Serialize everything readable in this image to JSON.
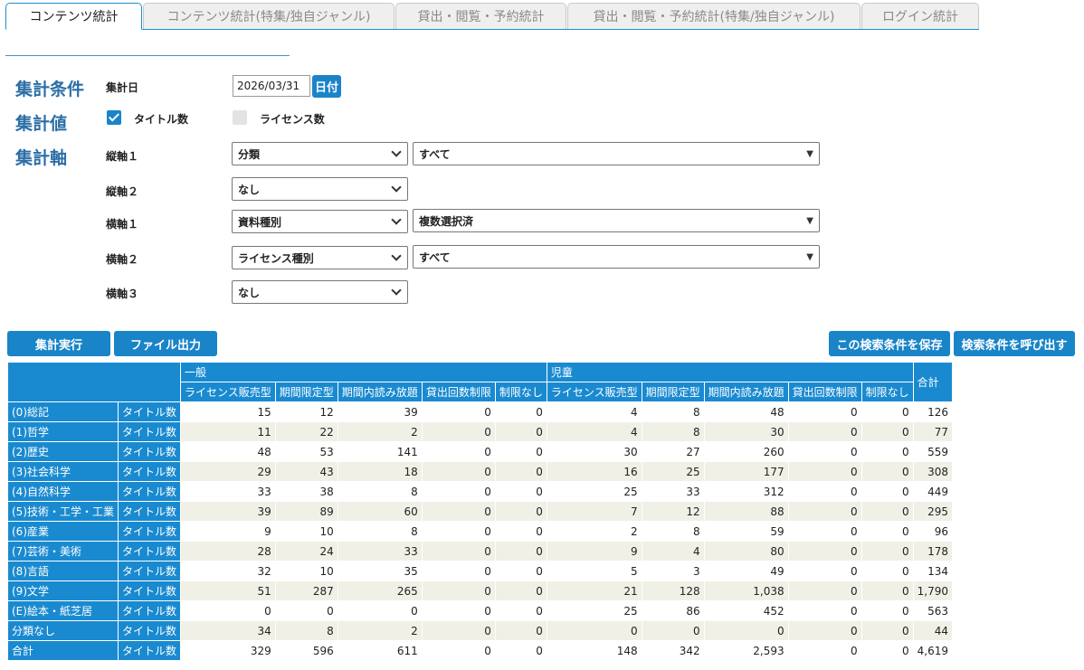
{
  "tabs": [
    {
      "label": "コンテンツ統計",
      "active": true
    },
    {
      "label": "コンテンツ統計(特集/独自ジャンル)",
      "active": false
    },
    {
      "label": "貸出・閲覧・予約統計",
      "active": false
    },
    {
      "label": "貸出・閲覧・予約統計(特集/独自ジャンル)",
      "active": false
    },
    {
      "label": "ログイン統計",
      "active": false
    }
  ],
  "conditions": {
    "section_label": "集計条件",
    "date_label": "集計日",
    "date_value": "2026/03/31",
    "date_button": "日付"
  },
  "values": {
    "section_label": "集計値",
    "title_count": {
      "label": "タイトル数",
      "checked": true
    },
    "license_count": {
      "label": "ライセンス数",
      "checked": false
    }
  },
  "axes": {
    "section_label": "集計軸",
    "v1": {
      "label": "縦軸１",
      "select": "分類",
      "filter": "すべて"
    },
    "v2": {
      "label": "縦軸２",
      "select": "なし"
    },
    "h1": {
      "label": "横軸１",
      "select": "資料種別",
      "filter": "複数選択済"
    },
    "h2": {
      "label": "横軸２",
      "select": "ライセンス種別",
      "filter": "すべて"
    },
    "h3": {
      "label": "横軸３",
      "select": "なし"
    }
  },
  "buttons": {
    "run": "集計実行",
    "export": "ファイル出力",
    "save": "この検索条件を保存",
    "load": "検索条件を呼び出す"
  },
  "table": {
    "group_general": "一般",
    "group_children": "児童",
    "total_header": "合計",
    "sub_headers": [
      "ライセンス販売型",
      "期間限定型",
      "期間内読み放題",
      "貸出回数制限",
      "制限なし"
    ],
    "rows": [
      {
        "label": "(0)総記",
        "metric": "タイトル数",
        "values": [
          "15",
          "12",
          "39",
          "0",
          "0",
          "4",
          "8",
          "48",
          "0",
          "0",
          "126"
        ]
      },
      {
        "label": "(1)哲学",
        "metric": "タイトル数",
        "values": [
          "11",
          "22",
          "2",
          "0",
          "0",
          "4",
          "8",
          "30",
          "0",
          "0",
          "77"
        ]
      },
      {
        "label": "(2)歴史",
        "metric": "タイトル数",
        "values": [
          "48",
          "53",
          "141",
          "0",
          "0",
          "30",
          "27",
          "260",
          "0",
          "0",
          "559"
        ]
      },
      {
        "label": "(3)社会科学",
        "metric": "タイトル数",
        "values": [
          "29",
          "43",
          "18",
          "0",
          "0",
          "16",
          "25",
          "177",
          "0",
          "0",
          "308"
        ]
      },
      {
        "label": "(4)自然科学",
        "metric": "タイトル数",
        "values": [
          "33",
          "38",
          "8",
          "0",
          "0",
          "25",
          "33",
          "312",
          "0",
          "0",
          "449"
        ]
      },
      {
        "label": "(5)技術・工学・工業",
        "metric": "タイトル数",
        "values": [
          "39",
          "89",
          "60",
          "0",
          "0",
          "7",
          "12",
          "88",
          "0",
          "0",
          "295"
        ]
      },
      {
        "label": "(6)産業",
        "metric": "タイトル数",
        "values": [
          "9",
          "10",
          "8",
          "0",
          "0",
          "2",
          "8",
          "59",
          "0",
          "0",
          "96"
        ]
      },
      {
        "label": "(7)芸術・美術",
        "metric": "タイトル数",
        "values": [
          "28",
          "24",
          "33",
          "0",
          "0",
          "9",
          "4",
          "80",
          "0",
          "0",
          "178"
        ]
      },
      {
        "label": "(8)言語",
        "metric": "タイトル数",
        "values": [
          "32",
          "10",
          "35",
          "0",
          "0",
          "5",
          "3",
          "49",
          "0",
          "0",
          "134"
        ]
      },
      {
        "label": "(9)文学",
        "metric": "タイトル数",
        "values": [
          "51",
          "287",
          "265",
          "0",
          "0",
          "21",
          "128",
          "1,038",
          "0",
          "0",
          "1,790"
        ]
      },
      {
        "label": "(E)絵本・紙芝居",
        "metric": "タイトル数",
        "values": [
          "0",
          "0",
          "0",
          "0",
          "0",
          "25",
          "86",
          "452",
          "0",
          "0",
          "563"
        ]
      },
      {
        "label": "分類なし",
        "metric": "タイトル数",
        "values": [
          "34",
          "8",
          "2",
          "0",
          "0",
          "0",
          "0",
          "0",
          "0",
          "0",
          "44"
        ]
      },
      {
        "label": "合計",
        "metric": "タイトル数",
        "values": [
          "329",
          "596",
          "611",
          "0",
          "0",
          "148",
          "342",
          "2,593",
          "0",
          "0",
          "4,619"
        ]
      }
    ]
  }
}
